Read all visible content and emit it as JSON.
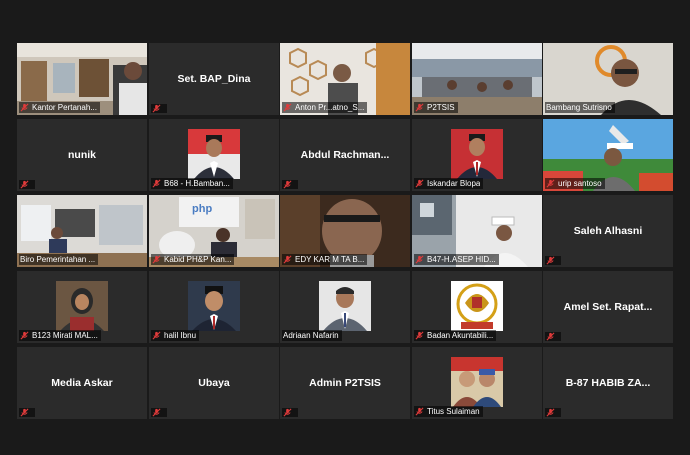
{
  "colors": {
    "background": "#1a1a1a",
    "tile": "#2b2b2b",
    "muted_icon": "#e03b3b",
    "active_speaker": "#d6e85a"
  },
  "participants": [
    {
      "name": "Kantor Pertanah...",
      "video": true
    },
    {
      "name": "Set. BAP_Dina",
      "video": false
    },
    {
      "name": "Anton Pr...atno_S...",
      "video": true
    },
    {
      "name": "P2TSIS",
      "video": true
    },
    {
      "name": "Bambang Sutrisno",
      "video": true
    },
    {
      "name": "nunik",
      "video": false
    },
    {
      "name": "B68 - H.Bamban...",
      "video": true
    },
    {
      "name": "Abdul  Rachman...",
      "video": false
    },
    {
      "name": "Iskandar Blopa",
      "video": true
    },
    {
      "name": "urip santoso",
      "video": true
    },
    {
      "name": "Biro Pemerintahan ...",
      "video": true,
      "active": true
    },
    {
      "name": "Kabid PH&P Kan...",
      "video": true,
      "wall_text": "php"
    },
    {
      "name": "EDY KAR M TA B...",
      "video": true
    },
    {
      "name": "B47-H.ASEP HID...",
      "video": true
    },
    {
      "name": "Saleh Alhasni",
      "video": false
    },
    {
      "name": "B123 Mirati MAL...",
      "video": true
    },
    {
      "name": "halil Ibnu",
      "video": true
    },
    {
      "name": "Adriaan Nafarin",
      "video": true
    },
    {
      "name": "Badan Akuntabili...",
      "video": true
    },
    {
      "name": "Amel Set. Rapat...",
      "video": false
    },
    {
      "name": "Media Askar",
      "video": false
    },
    {
      "name": "Ubaya",
      "video": false
    },
    {
      "name": "Admin P2TSIS",
      "video": false
    },
    {
      "name": "Titus Sulaiman",
      "video": true
    },
    {
      "name": "B-87 HABIB ZA...",
      "video": false
    }
  ]
}
